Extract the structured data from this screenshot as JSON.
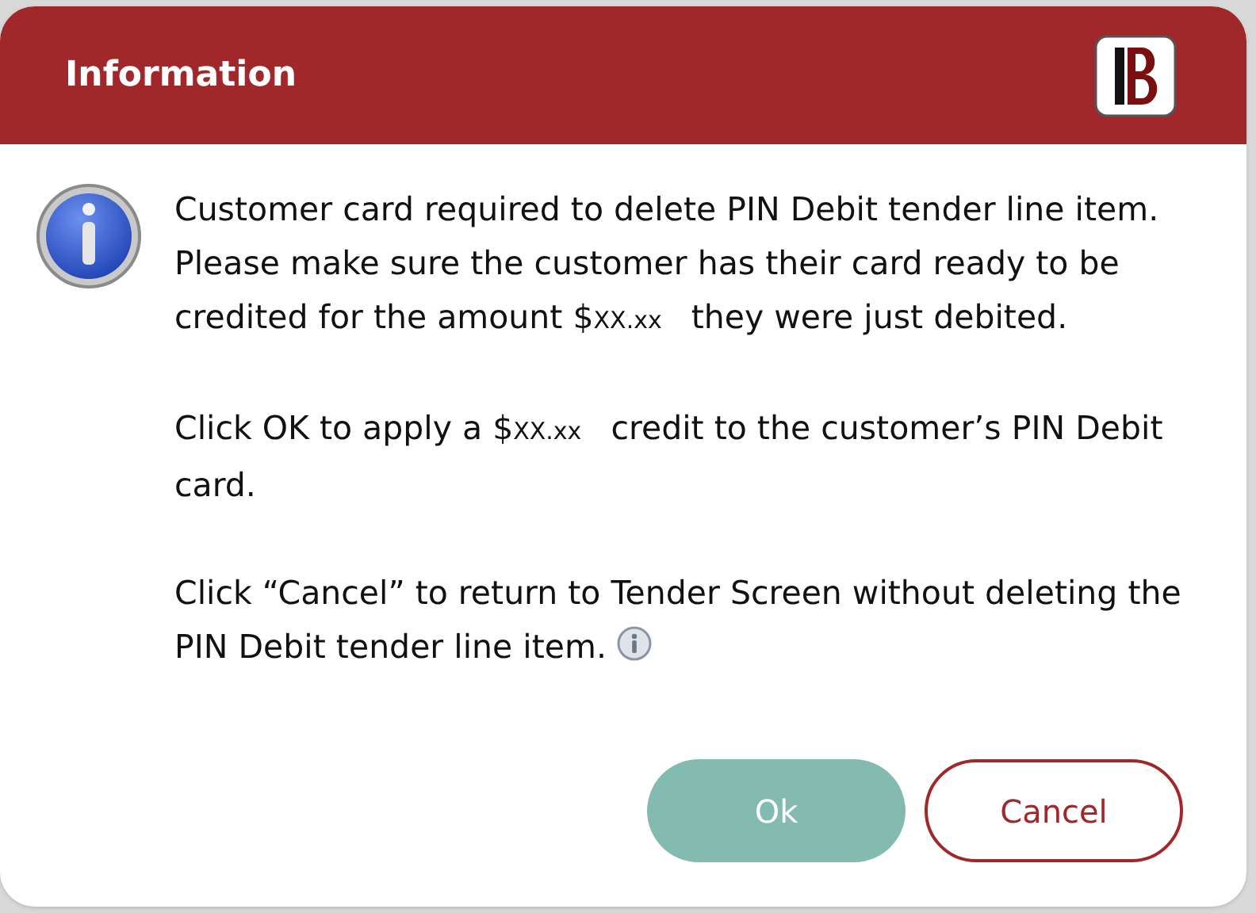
{
  "dialog": {
    "title": "Information",
    "paragraphs": [
      [
        {
          "kind": "text",
          "text": "Customer card required to delete PIN Debit tender line item. Please make sure the customer has their card ready to be credited for the amount $"
        },
        {
          "kind": "amount",
          "text": "XX.xx"
        },
        {
          "kind": "text",
          "text": " they were just debited."
        }
      ],
      [
        {
          "kind": "text",
          "text": "Click OK to apply a $"
        },
        {
          "kind": "amount",
          "text": "XX.xx"
        },
        {
          "kind": "text",
          "text": " credit to the customer’s PIN Debit card."
        }
      ],
      [
        {
          "kind": "text",
          "text": "Click “Cancel” to return to Tender Screen without deleting the PIN Debit tender line item."
        }
      ]
    ],
    "buttons": [
      {
        "label": "Ok",
        "kind": "primary"
      },
      {
        "label": "Cancel",
        "kind": "secondary"
      }
    ]
  }
}
